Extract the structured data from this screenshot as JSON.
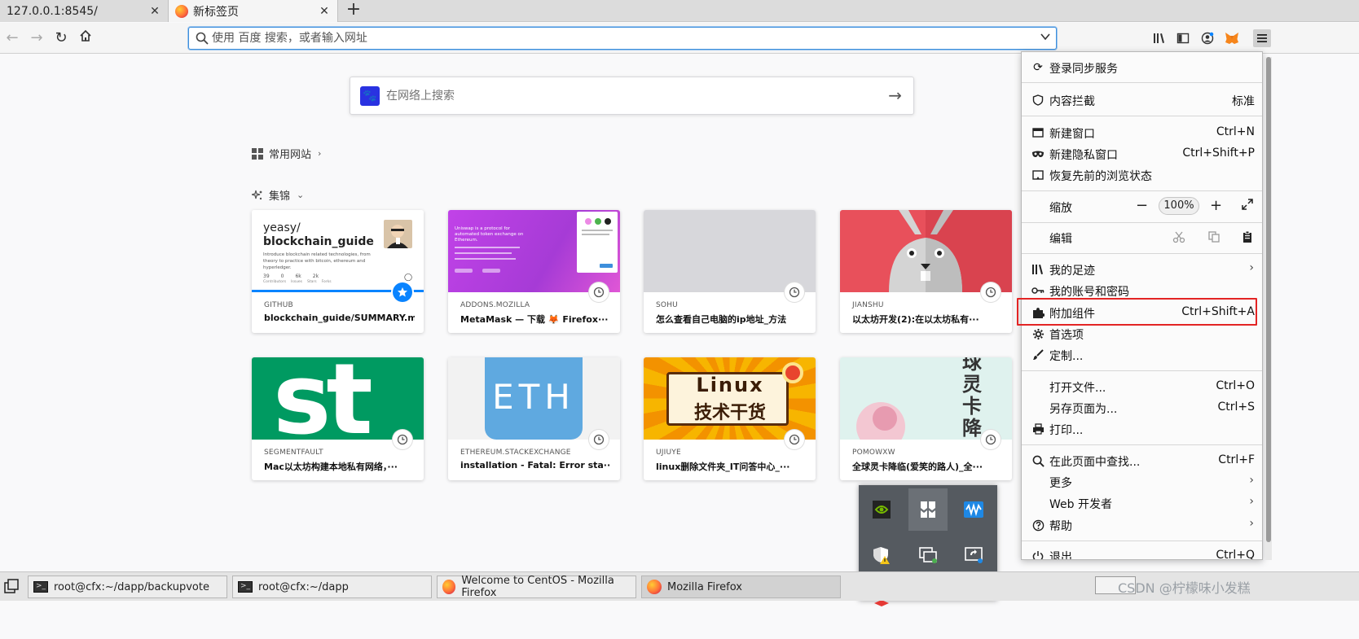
{
  "tabs": [
    {
      "label": "127.0.0.1:8545/"
    },
    {
      "label": "新标签页"
    }
  ],
  "urlbar": {
    "placeholder": "使用 百度 搜索，或者输入网址"
  },
  "page_search": {
    "placeholder": "在网络上搜索"
  },
  "sections": {
    "top_sites": "常用网站",
    "highlights": "集锦"
  },
  "cards": [
    {
      "source": "GITHUB",
      "title": "blockchain_guide/SUMMARY.m···",
      "thumb_title_1": "yeasy/",
      "thumb_title_2": "blockchain_guide",
      "thumb_desc": "Introduce blockchain related technologies, from theory to practice with bitcoin, ethereum and hyperledger.",
      "stats": [
        "39",
        "0",
        "6k",
        "2k"
      ],
      "stat_labels": [
        "Contributors",
        "Issues",
        "Stars",
        "Forks"
      ]
    },
    {
      "source": "ADDONS.MOZILLA",
      "title": "MetaMask — 下载 🦊 Firefox···",
      "thumb_text": "Uniswap is a protocol for automated token exchange on Ethereum."
    },
    {
      "source": "SOHU",
      "title": "怎么查看自己电脑的ip地址_方法"
    },
    {
      "source": "JIANSHU",
      "title": "以太坊开发(2):在以太坊私有···"
    },
    {
      "source": "SEGMENTFAULT",
      "title": "Mac以太坊构建本地私有网络，···",
      "thumb_text": "st"
    },
    {
      "source": "ETHEREUM.STACKEXCHANGE",
      "title": "installation - Fatal: Error sta···",
      "thumb_text": "ETH"
    },
    {
      "source": "UJIUYE",
      "title": "linux删除文件夹_IT问答中心_···",
      "thumb_text_1": "Linux",
      "thumb_text_2": "技术干货"
    },
    {
      "source": "POMOWXW",
      "title": "全球灵卡降临(爱笑的路人)_全···",
      "thumb_text": "球灵卡降临"
    }
  ],
  "menu": {
    "sync": "登录同步服务",
    "content_blocking": "内容拦截",
    "content_blocking_value": "标准",
    "new_window": "新建窗口",
    "new_window_sc": "Ctrl+N",
    "new_private": "新建隐私窗口",
    "new_private_sc": "Ctrl+Shift+P",
    "restore": "恢复先前的浏览状态",
    "zoom": "缩放",
    "zoom_value": "100%",
    "edit": "编辑",
    "library": "我的足迹",
    "logins": "我的账号和密码",
    "addons": "附加组件",
    "addons_sc": "Ctrl+Shift+A",
    "options": "首选项",
    "customize": "定制...",
    "open_file": "打开文件...",
    "open_file_sc": "Ctrl+O",
    "save_page": "另存页面为...",
    "save_page_sc": "Ctrl+S",
    "print": "打印...",
    "find": "在此页面中查找...",
    "find_sc": "Ctrl+F",
    "more": "更多",
    "web_dev": "Web 开发者",
    "help": "帮助",
    "quit": "退出",
    "quit_sc": "Ctrl+Q"
  },
  "taskbar": [
    {
      "label": "root@cfx:~/dapp/backupvote"
    },
    {
      "label": "root@cfx:~/dapp"
    },
    {
      "label": "Welcome to CentOS - Mozilla Firefox"
    },
    {
      "label": "Mozilla Firefox"
    }
  ],
  "watermark": "CSDN @柠檬味小发糕",
  "colors": {
    "accent": "#3d8fdc",
    "highlight_box": "#e32424",
    "github_bar": "#0a84ff"
  }
}
